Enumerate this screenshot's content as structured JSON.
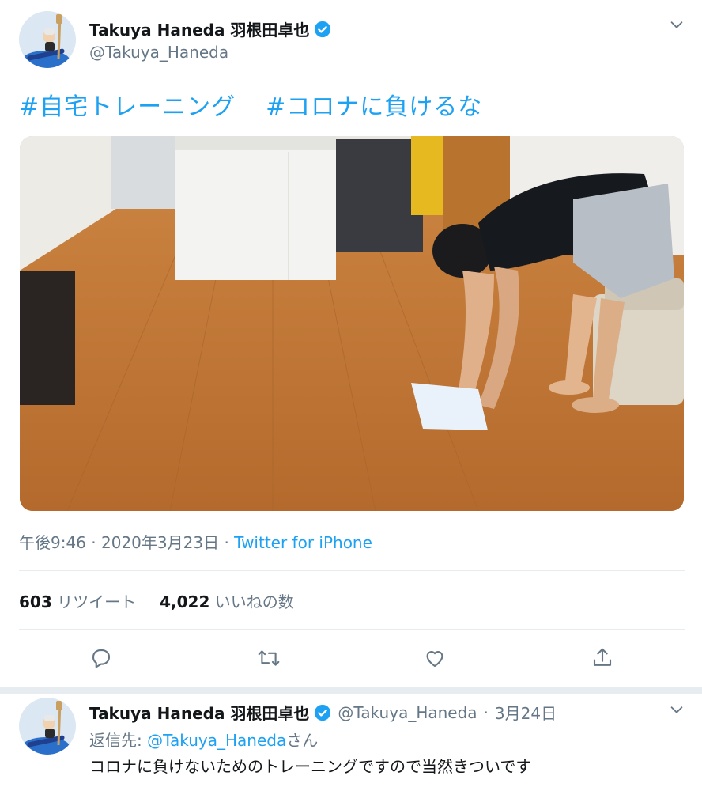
{
  "tweet": {
    "display_name": "Takuya Haneda 羽根田卓也",
    "handle": "@Takuya_Haneda",
    "hashtags": [
      "#自宅トレーニング",
      "#コロナに負けるな"
    ],
    "time": "午後9:46",
    "date": "2020年3月23日",
    "separator": "·",
    "source": "Twitter for iPhone",
    "retweets_count": "603",
    "retweets_label": "リツイート",
    "likes_count": "4,022",
    "likes_label": "いいねの数"
  },
  "icons": {
    "verified": "verified-badge-icon",
    "more": "chevron-down-icon",
    "reply": "reply-icon",
    "retweet": "retweet-icon",
    "like": "heart-icon",
    "share": "share-icon"
  },
  "reply": {
    "display_name": "Takuya Haneda 羽根田卓也",
    "handle": "@Takuya_Haneda",
    "separator": "·",
    "date": "3月24日",
    "replying_prefix": "返信先:",
    "replying_handle": "@Takuya_Haneda",
    "replying_suffix": "さん",
    "text": "コロナに負けないためのトレーニングですので当然きついです"
  },
  "colors": {
    "accent": "#1da1f2",
    "secondary_text": "#657786",
    "border": "#e6ecf0"
  }
}
